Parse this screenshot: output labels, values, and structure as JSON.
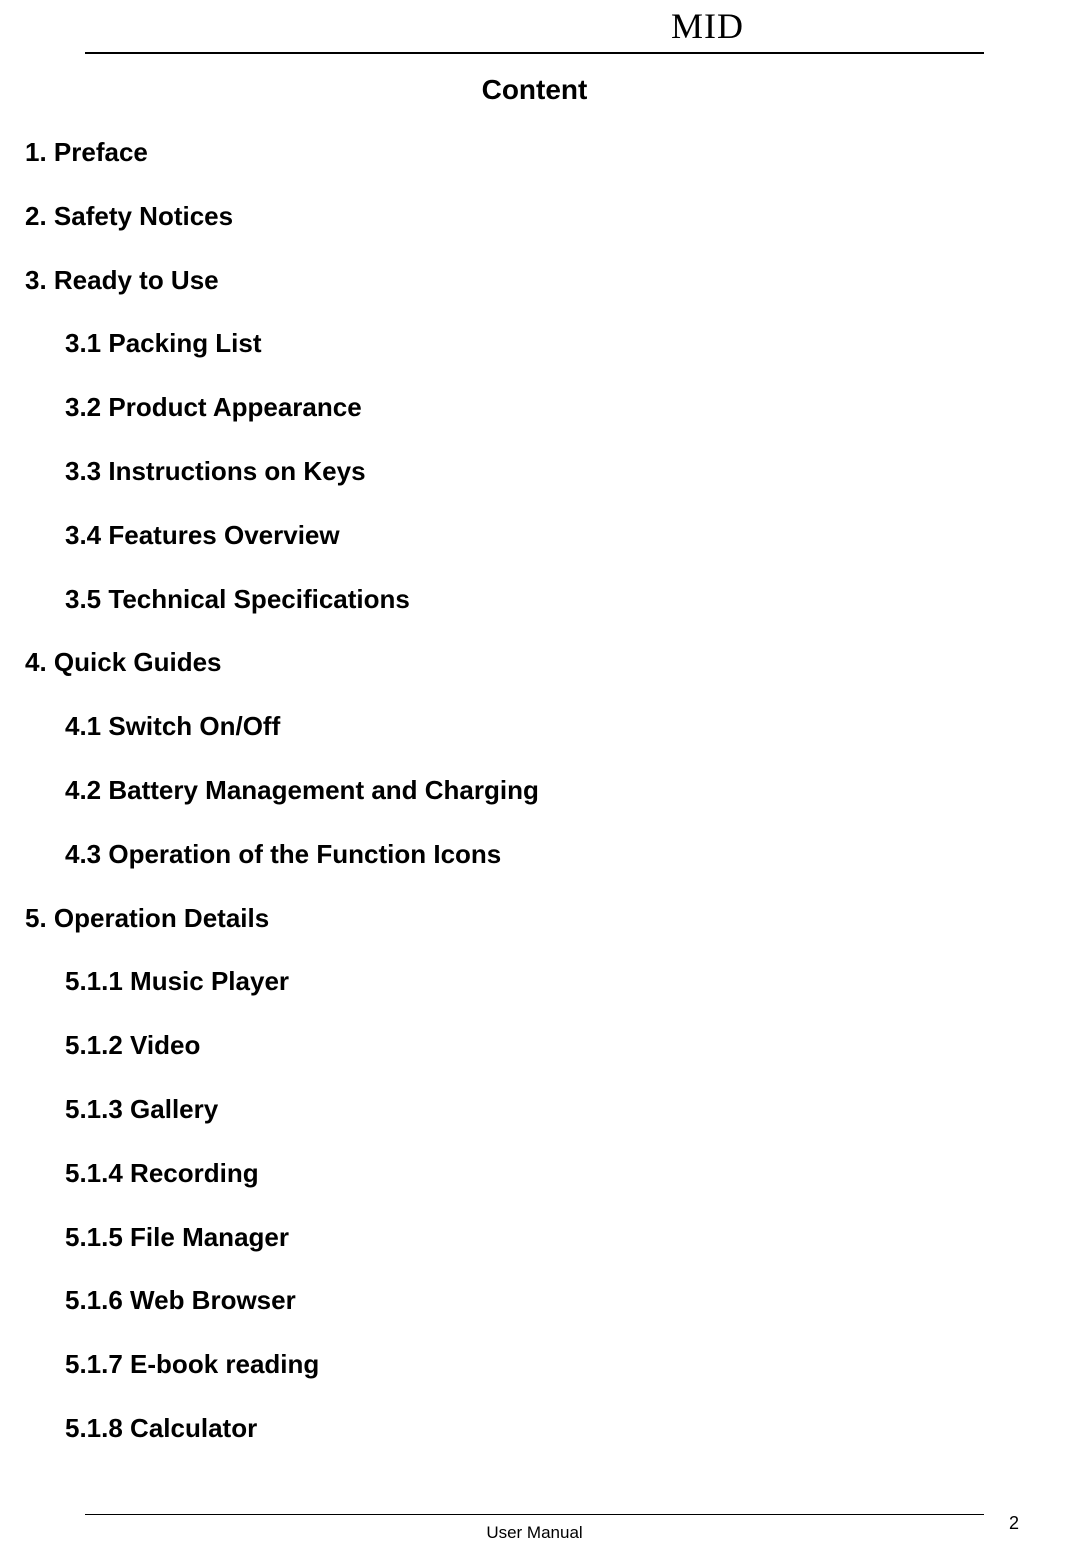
{
  "header": {
    "brand": "MID"
  },
  "title": "Content",
  "toc": [
    {
      "label": "1. Preface",
      "level": 0
    },
    {
      "label": "2. Safety Notices",
      "level": 0
    },
    {
      "label": "3. Ready to Use",
      "level": 0
    },
    {
      "label": "3.1 Packing List",
      "level": 1
    },
    {
      "label": "3.2 Product Appearance",
      "level": 1
    },
    {
      "label": "3.3 Instructions on Keys",
      "level": 1
    },
    {
      "label": "3.4 Features Overview",
      "level": 1
    },
    {
      "label": "3.5 Technical Specifications",
      "level": 1
    },
    {
      "label": "4. Quick Guides",
      "level": 0
    },
    {
      "label": "4.1 Switch On/Off",
      "level": 1
    },
    {
      "label": "4.2 Battery Management and Charging",
      "level": 1
    },
    {
      "label": "4.3 Operation of the Function Icons",
      "level": 1
    },
    {
      "label": "5. Operation Details",
      "level": 0
    },
    {
      "label": "5.1.1 Music Player",
      "level": 1
    },
    {
      "label": "5.1.2 Video",
      "level": 1
    },
    {
      "label": "5.1.3 Gallery",
      "level": 1
    },
    {
      "label": "5.1.4 Recording",
      "level": 1
    },
    {
      "label": "5.1.5 File Manager",
      "level": 1
    },
    {
      "label": "5.1.6 Web Browser",
      "level": 1
    },
    {
      "label": "5.1.7 E-book reading",
      "level": 1
    },
    {
      "label": "5.1.8 Calculator",
      "level": 1
    }
  ],
  "footer": {
    "label": "User Manual",
    "page_number": "2"
  }
}
